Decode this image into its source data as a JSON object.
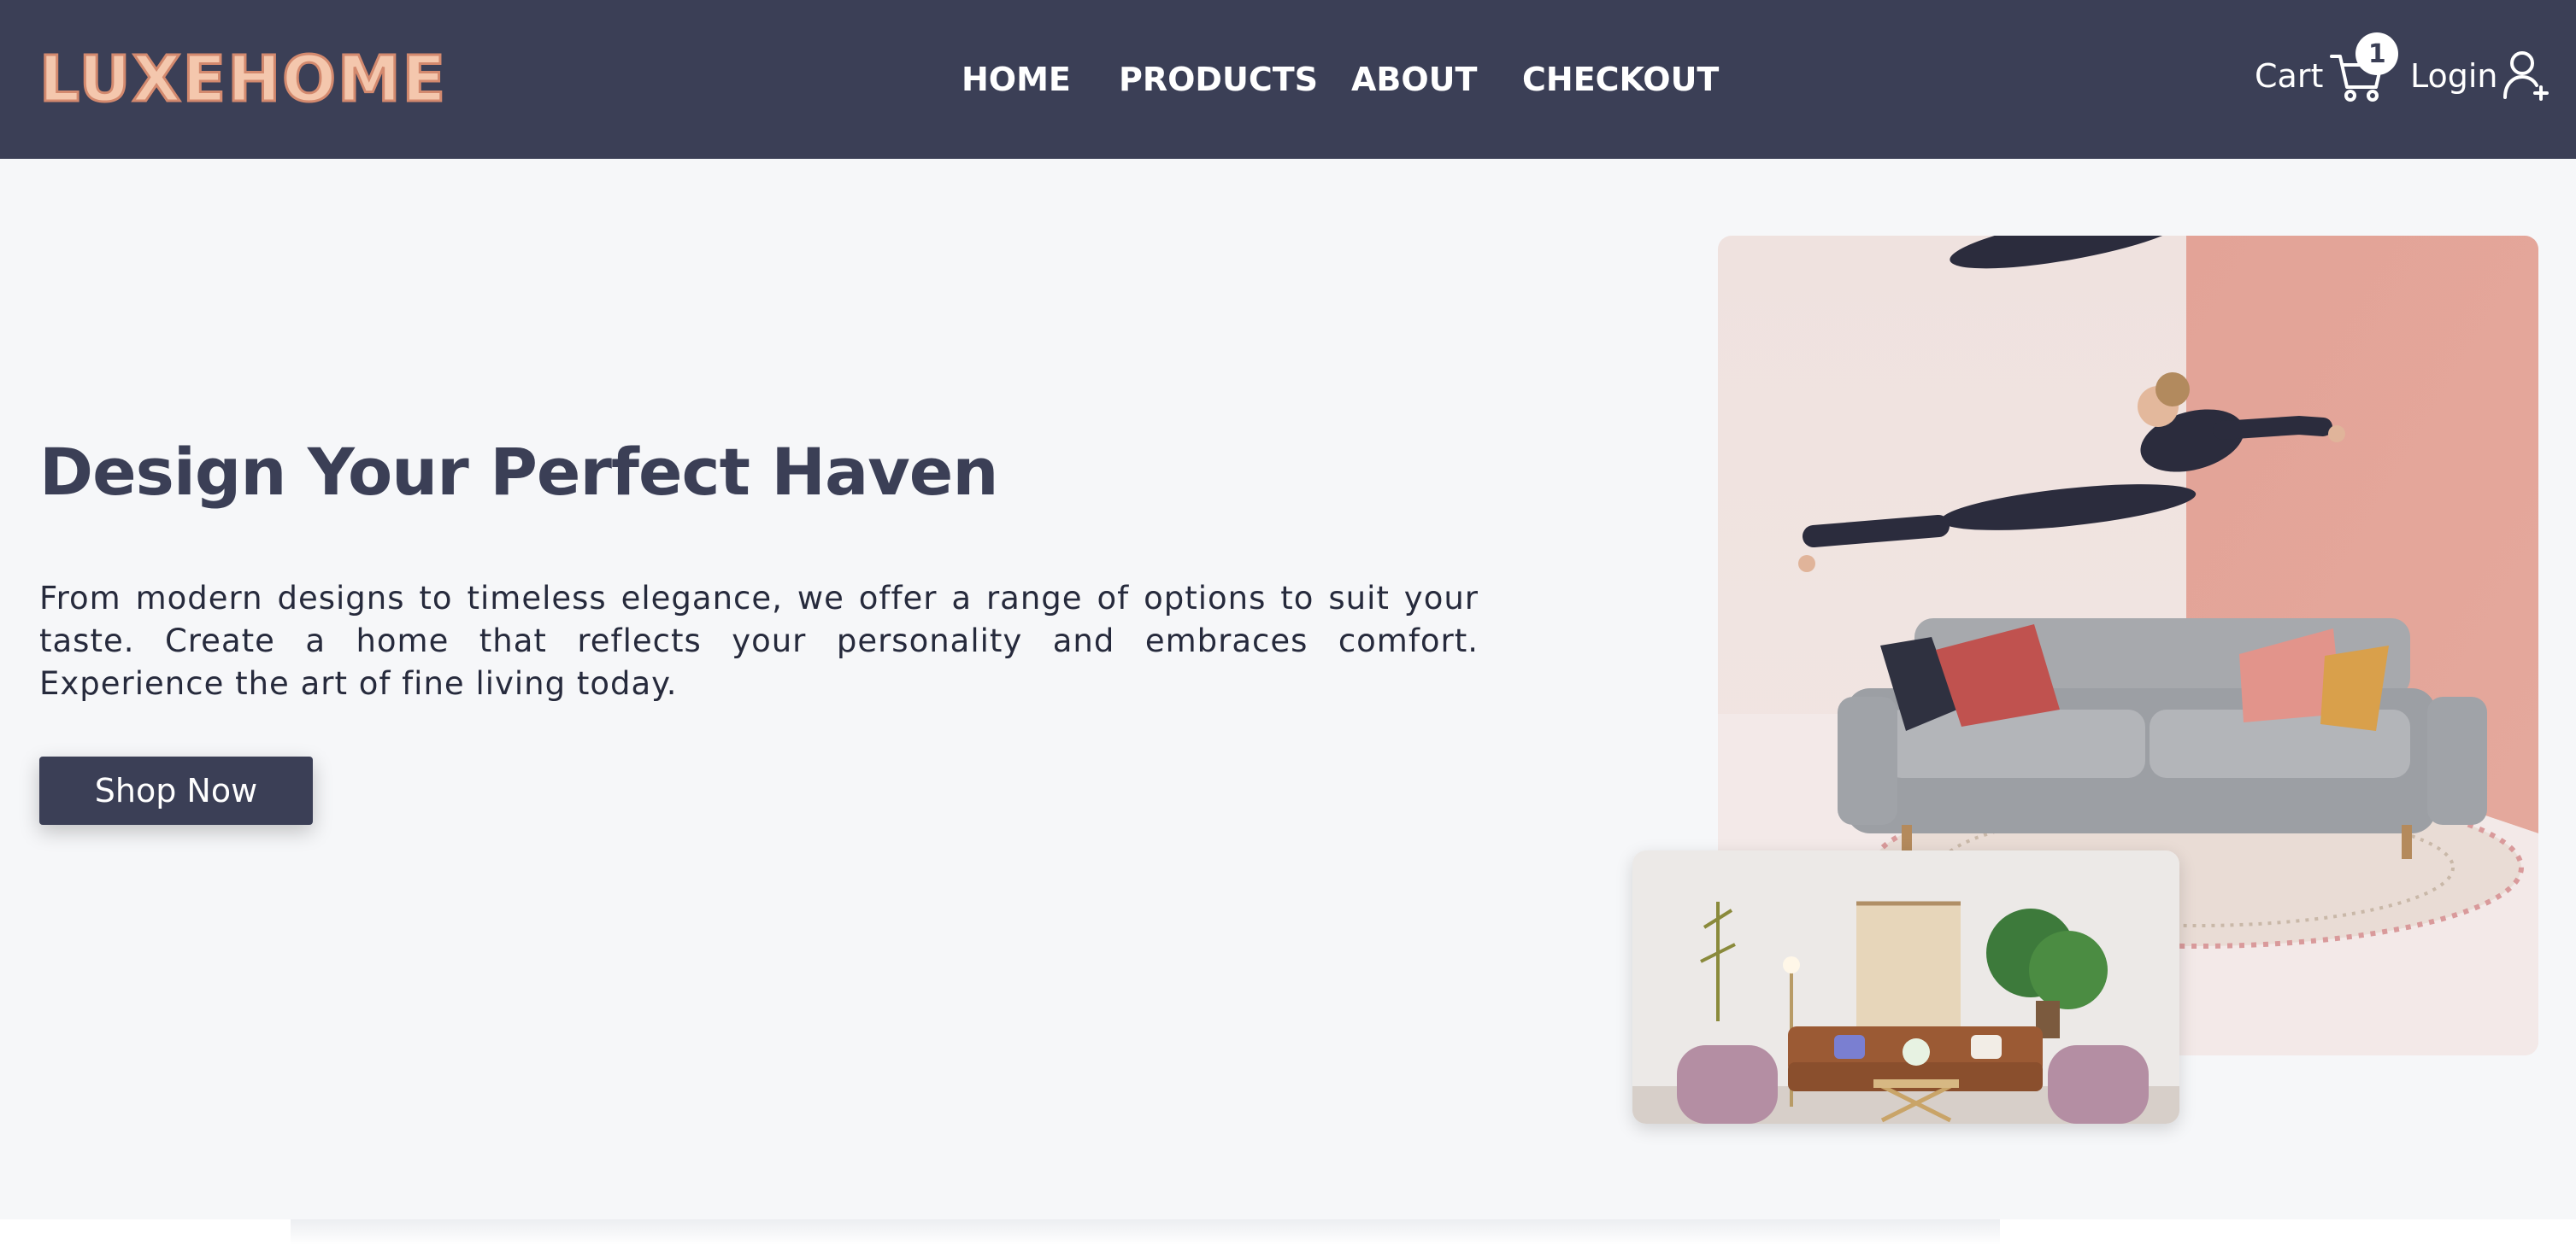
{
  "brand": {
    "logo_text": "LUXEHOME"
  },
  "nav": {
    "links": [
      {
        "label": "HOME"
      },
      {
        "label": "PRODUCTS"
      },
      {
        "label": "ABOUT"
      },
      {
        "label": "CHECKOUT"
      }
    ],
    "cart_label": "Cart",
    "cart_count": "1",
    "login_label": "Login"
  },
  "hero": {
    "title": "Design Your Perfect Haven",
    "description": "From modern designs to timeless elegance, we offer a range of options to suit your taste. Create a home that reflects your personality and embraces comfort. Experience the art of fine living today.",
    "cta_label": "Shop Now"
  },
  "colors": {
    "navbar_bg": "#3b3f56",
    "logo_fill": "#f4c7ad",
    "page_bg": "#f6f7f9",
    "button_bg": "#3b3f56"
  },
  "icons": [
    "cart-icon",
    "add-user-icon"
  ]
}
